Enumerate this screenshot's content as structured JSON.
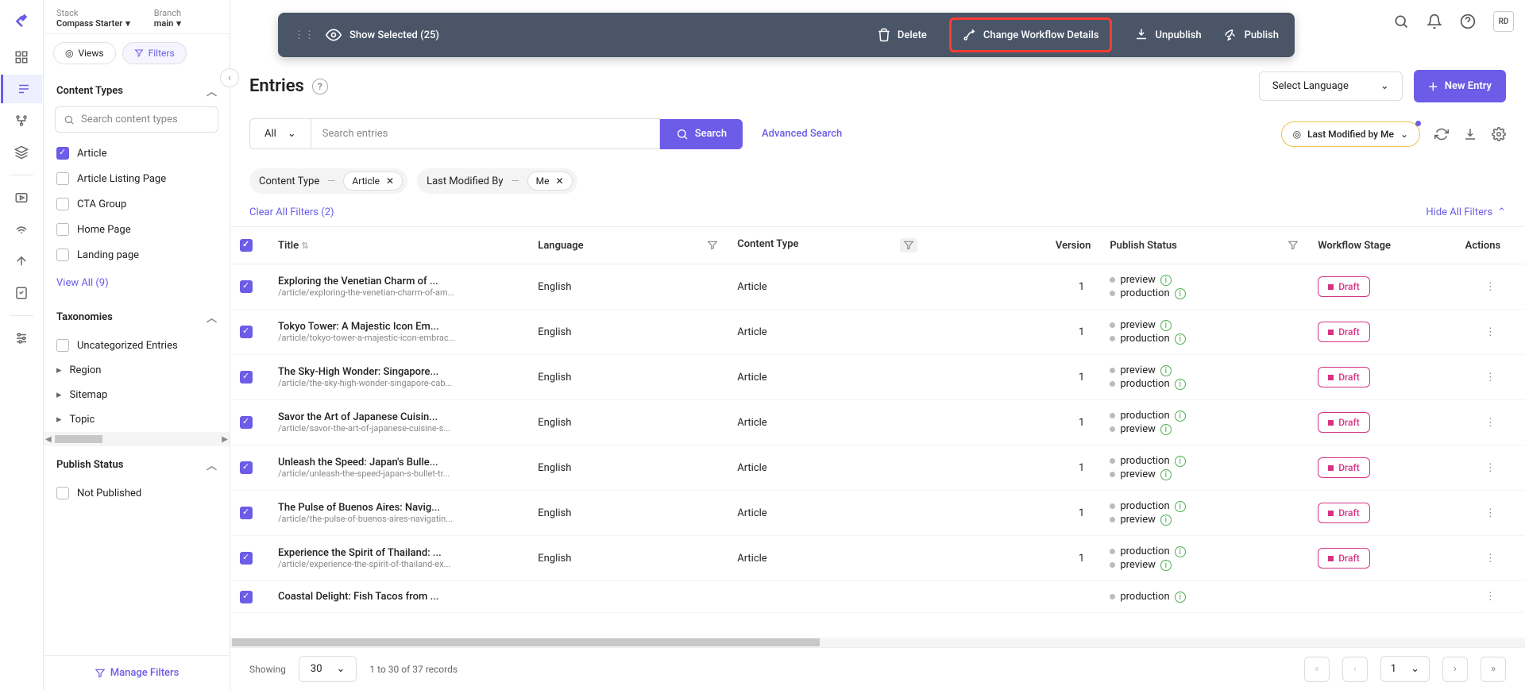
{
  "top": {
    "stack_label": "Stack",
    "stack_value": "Compass Starter",
    "branch_label": "Branch",
    "branch_value": "main"
  },
  "global_avatar": "RD",
  "sidebar": {
    "views_label": "Views",
    "filters_label": "Filters",
    "content_types_header": "Content Types",
    "search_ct_placeholder": "Search content types",
    "content_types": [
      {
        "label": "Article",
        "checked": true
      },
      {
        "label": "Article Listing Page",
        "checked": false
      },
      {
        "label": "CTA Group",
        "checked": false
      },
      {
        "label": "Home Page",
        "checked": false
      },
      {
        "label": "Landing page",
        "checked": false
      }
    ],
    "view_all": "View All (9)",
    "taxonomies_header": "Taxonomies",
    "taxonomies": [
      {
        "label": "Uncategorized Entries",
        "type": "check"
      },
      {
        "label": "Region",
        "type": "caret"
      },
      {
        "label": "Sitemap",
        "type": "caret"
      },
      {
        "label": "Topic",
        "type": "caret"
      }
    ],
    "publish_status_header": "Publish Status",
    "publish_status_item": "Not Published",
    "manage_filters": "Manage Filters"
  },
  "action_bar": {
    "show_selected": "Show Selected (25)",
    "delete": "Delete",
    "change_workflow": "Change Workflow Details",
    "unpublish": "Unpublish",
    "publish": "Publish"
  },
  "page": {
    "title": "Entries",
    "select_language": "Select Language",
    "new_entry": "New Entry"
  },
  "search": {
    "all": "All",
    "placeholder": "Search entries",
    "button": "Search",
    "advanced": "Advanced Search",
    "last_modified": "Last Modified by Me"
  },
  "chips": {
    "content_type": "Content Type",
    "article": "Article",
    "last_modified_by": "Last Modified By",
    "me": "Me",
    "clear": "Clear All Filters (2)",
    "hide": "Hide All Filters"
  },
  "table": {
    "headers": [
      "",
      "Title",
      "Language",
      "Content Type",
      "Version",
      "Publish Status",
      "Workflow Stage",
      "Actions"
    ],
    "rows": [
      {
        "title": "Exploring the Venetian Charm of ...",
        "slug": "/article/exploring-the-venetian-charm-of-am...",
        "lang": "English",
        "ct": "Article",
        "ver": "1",
        "pub": [
          "preview",
          "production"
        ],
        "stage": "Draft"
      },
      {
        "title": "Tokyo Tower: A Majestic Icon Em...",
        "slug": "/article/tokyo-tower-a-majestic-icon-embrac...",
        "lang": "English",
        "ct": "Article",
        "ver": "1",
        "pub": [
          "preview",
          "production"
        ],
        "stage": "Draft"
      },
      {
        "title": "The Sky-High Wonder: Singapore...",
        "slug": "/article/the-sky-high-wonder-singapore-cab...",
        "lang": "English",
        "ct": "Article",
        "ver": "1",
        "pub": [
          "preview",
          "production"
        ],
        "stage": "Draft"
      },
      {
        "title": "Savor the Art of Japanese Cuisin...",
        "slug": "/article/savor-the-art-of-japanese-cuisine-s...",
        "lang": "English",
        "ct": "Article",
        "ver": "1",
        "pub": [
          "production",
          "preview"
        ],
        "stage": "Draft"
      },
      {
        "title": "Unleash the Speed: Japan's Bulle...",
        "slug": "/article/unleash-the-speed-japan-s-bullet-tr...",
        "lang": "English",
        "ct": "Article",
        "ver": "1",
        "pub": [
          "production",
          "preview"
        ],
        "stage": "Draft"
      },
      {
        "title": "The Pulse of Buenos Aires: Navig...",
        "slug": "/article/the-pulse-of-buenos-aires-navigatin...",
        "lang": "English",
        "ct": "Article",
        "ver": "1",
        "pub": [
          "production",
          "preview"
        ],
        "stage": "Draft"
      },
      {
        "title": "Experience the Spirit of Thailand: ...",
        "slug": "/article/experience-the-spirit-of-thailand-ex...",
        "lang": "English",
        "ct": "Article",
        "ver": "1",
        "pub": [
          "production",
          "preview"
        ],
        "stage": "Draft"
      },
      {
        "title": "Coastal Delight: Fish Tacos from ...",
        "slug": "",
        "lang": "",
        "ct": "",
        "ver": "",
        "pub": [
          "production"
        ],
        "stage": ""
      }
    ]
  },
  "footer": {
    "showing": "Showing",
    "per_page": "30",
    "range": "1 to 30 of 37 records",
    "page": "1"
  }
}
